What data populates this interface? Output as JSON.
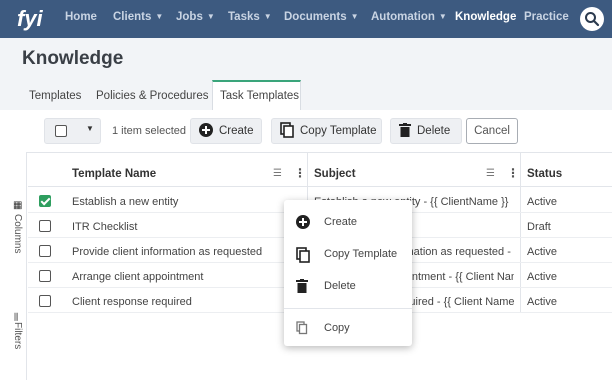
{
  "nav": {
    "logo": "fyi",
    "items": [
      {
        "label": "Home",
        "caret": ""
      },
      {
        "label": "Clients",
        "caret": "▼"
      },
      {
        "label": "Jobs",
        "caret": "▼"
      },
      {
        "label": "Tasks",
        "caret": "▼"
      },
      {
        "label": "Documents",
        "caret": "▼"
      },
      {
        "label": "Automation",
        "caret": "▼"
      },
      {
        "label": "Knowledge",
        "caret": ""
      },
      {
        "label": "Practice",
        "caret": ""
      }
    ],
    "active": "Knowledge",
    "icon": "search-icon"
  },
  "page": {
    "title": "Knowledge"
  },
  "tabs": {
    "items": [
      "Templates",
      "Policies & Procedures",
      "Task Templates"
    ],
    "active": "Task Templates"
  },
  "toolbar": {
    "selection_text": "1 item selected",
    "create_label": "Create",
    "copy_label": "Copy Template",
    "delete_label": "Delete",
    "cancel_label": "Cancel"
  },
  "sidebar": {
    "columns_label": "Columns",
    "filters_label": "Filters"
  },
  "table": {
    "headers": [
      "Template Name",
      "Subject",
      "Status"
    ],
    "rows": [
      {
        "name": "Establish a new entity",
        "subject": "Establish a new entity - {{ ClientName }}",
        "status": "Active",
        "checked": true
      },
      {
        "name": "ITR Checklist",
        "subject": "",
        "status": "Draft",
        "checked": false
      },
      {
        "name": "Provide client information as requested",
        "subject": "Provide client information as requested - {{ Client Name }}",
        "status": "Active",
        "checked": false
      },
      {
        "name": "Arrange client appointment",
        "subject": "Arrange client appointment - {{ Client Name }}",
        "status": "Active",
        "checked": false
      },
      {
        "name": "Client response required",
        "subject": "Client response required - {{ Client Name }}",
        "status": "Active",
        "checked": false
      }
    ]
  },
  "context_menu": {
    "items": [
      {
        "label": "Create",
        "icon": "plus-circle-icon"
      },
      {
        "label": "Copy Template",
        "icon": "copy-icon"
      },
      {
        "label": "Delete",
        "icon": "trash-icon"
      },
      {
        "label": "Copy",
        "icon": "copy-small-icon"
      }
    ]
  },
  "colors": {
    "nav_bg": "#3d5a80",
    "accent": "#3aa57b",
    "check": "#2e9e5f"
  }
}
